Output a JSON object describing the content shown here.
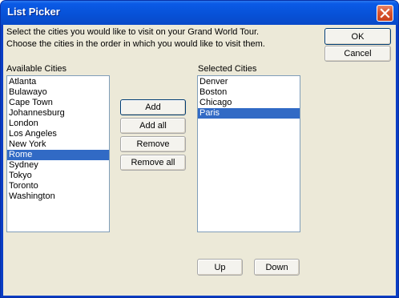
{
  "window": {
    "title": "List Picker",
    "close_icon": "close-icon"
  },
  "instructions": {
    "line1": "Select the cities you would like to visit on your Grand World Tour.",
    "line2": "Choose the cities in the order in which you would like to visit them."
  },
  "buttons": {
    "ok": "OK",
    "cancel": "Cancel",
    "add": "Add",
    "add_all": "Add all",
    "remove": "Remove",
    "remove_all": "Remove all",
    "up": "Up",
    "down": "Down"
  },
  "available": {
    "label": "Available Cities",
    "items": [
      "Atlanta",
      "Bulawayo",
      "Cape Town",
      "Johannesburg",
      "London",
      "Los Angeles",
      "New York",
      "Rome",
      "Sydney",
      "Tokyo",
      "Toronto",
      "Washington"
    ],
    "selected": "Rome"
  },
  "selected": {
    "label": "Selected Cities",
    "items": [
      "Denver",
      "Boston",
      "Chicago",
      "Paris"
    ],
    "selected": "Paris"
  },
  "colors": {
    "title_bar": "#0752d8",
    "selection": "#316ac5",
    "dialog_bg": "#ece9d8"
  }
}
